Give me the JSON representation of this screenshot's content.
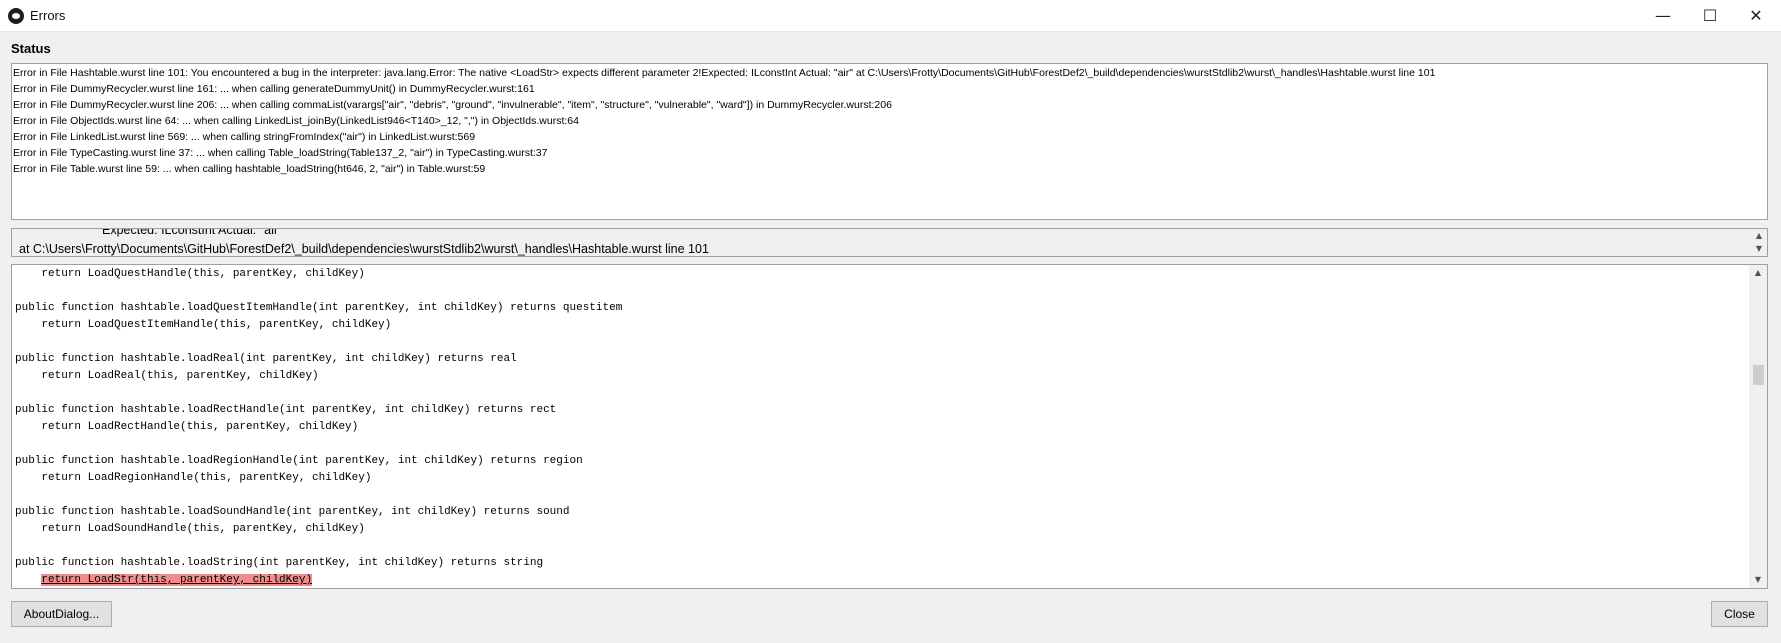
{
  "window": {
    "title": "Errors",
    "controls": {
      "minimize": "—",
      "maximize": "☐",
      "close": "✕"
    }
  },
  "status_label": "Status",
  "errors": [
    "Error in File Hashtable.wurst line 101: You encountered a bug in the interpreter: java.lang.Error: The native <LoadStr> expects different parameter 2!Expected: ILconstInt Actual: \"air\"  at C:\\Users\\Frotty\\Documents\\GitHub\\ForestDef2\\_build\\dependencies\\wurstStdlib2\\wurst\\_handles\\Hashtable.wurst line 101",
    "Error in File DummyRecycler.wurst line 161: ... when calling generateDummyUnit() in DummyRecycler.wurst:161",
    "Error in File DummyRecycler.wurst line 206: ... when calling commaList(varargs[\"air\", \"debris\", \"ground\", \"invulnerable\", \"item\", \"structure\", \"vulnerable\", \"ward\"]) in DummyRecycler.wurst:206",
    "Error in File ObjectIds.wurst line 64: ... when calling LinkedList_joinBy(LinkedList946<T140>_12, \",\") in ObjectIds.wurst:64",
    "Error in File LinkedList.wurst line 569: ... when calling stringFromIndex(\"air\") in LinkedList.wurst:569",
    "Error in File TypeCasting.wurst line 37: ... when calling Table_loadString(Table137_2, \"air\") in TypeCasting.wurst:37",
    "Error in File Table.wurst line 59: ... when calling hashtable_loadString(ht646, 2, \"air\") in Table.wurst:59"
  ],
  "detail": {
    "line1": "Expected: ILconstInt Actual: \"air\"",
    "line2": "at C:\\Users\\Frotty\\Documents\\GitHub\\ForestDef2\\_build\\dependencies\\wurstStdlib2\\wurst\\_handles\\Hashtable.wurst line 101"
  },
  "code_lines": [
    "    return LoadQuestHandle(this, parentKey, childKey)",
    "",
    "public function hashtable.loadQuestItemHandle(int parentKey, int childKey) returns questitem",
    "    return LoadQuestItemHandle(this, parentKey, childKey)",
    "",
    "public function hashtable.loadReal(int parentKey, int childKey) returns real",
    "    return LoadReal(this, parentKey, childKey)",
    "",
    "public function hashtable.loadRectHandle(int parentKey, int childKey) returns rect",
    "    return LoadRectHandle(this, parentKey, childKey)",
    "",
    "public function hashtable.loadRegionHandle(int parentKey, int childKey) returns region",
    "    return LoadRegionHandle(this, parentKey, childKey)",
    "",
    "public function hashtable.loadSoundHandle(int parentKey, int childKey) returns sound",
    "    return LoadSoundHandle(this, parentKey, childKey)",
    "",
    "public function hashtable.loadString(int parentKey, int childKey) returns string"
  ],
  "highlighted_line": {
    "indent": "    ",
    "text": "return LoadStr(this, parentKey, childKey)"
  },
  "buttons": {
    "about": "AboutDialog...",
    "close": "Close"
  },
  "colors": {
    "highlight": "#f08c8c",
    "window_bg": "#f0f0f0"
  }
}
